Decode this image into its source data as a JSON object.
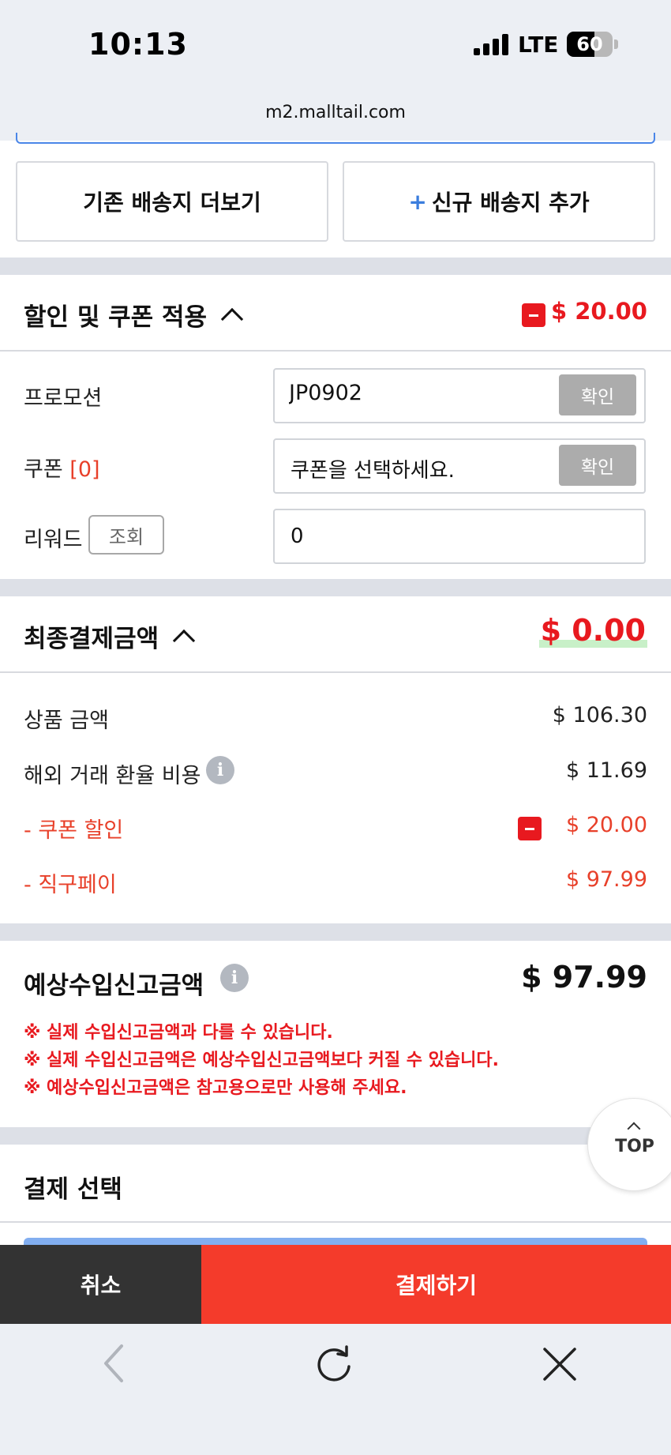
{
  "status": {
    "time": "10:13",
    "network": "LTE",
    "battery": "60"
  },
  "browser": {
    "url": "m2.malltail.com"
  },
  "address_buttons": {
    "more_label": "기존 배송지 더보기",
    "add_plus": "+",
    "add_label": "신규 배송지 추가"
  },
  "discount": {
    "title": "할인 및 쿠폰 적용",
    "amount": "$ 20.00",
    "promotion_label": "프로모션",
    "promotion_value": "JP0902",
    "confirm_label": "확인",
    "coupon_label": "쿠폰",
    "coupon_count": "[0]",
    "coupon_placeholder": "쿠폰을 선택하세요.",
    "reward_label": "리워드",
    "lookup_label": "조회",
    "reward_value": "0"
  },
  "final": {
    "title": "최종결제금액",
    "total": "$ 0.00",
    "rows": [
      {
        "label": "상품 금액",
        "value": "$ 106.30"
      },
      {
        "label": "해외 거래 환율 비용",
        "value": "$ 11.69"
      },
      {
        "label": "- 쿠폰 할인",
        "value": "$ 20.00"
      },
      {
        "label": "- 직구페이",
        "value": "$ 97.99"
      }
    ]
  },
  "customs": {
    "title": "예상수입신고금액",
    "amount": "$ 97.99",
    "notices": [
      "※ 실제 수입신고금액과 다를 수 있습니다.",
      "※ 실제 수입신고금액은 예상수입신고금액보다 커질 수 있습니다.",
      "※ 예상수입신고금액은 참고용으로만 사용해 주세요."
    ]
  },
  "top_button": {
    "label": "TOP"
  },
  "payment": {
    "title": "결제 선택"
  },
  "actions": {
    "cancel": "취소",
    "pay": "결제하기"
  },
  "colors": {
    "accent_red": "#e8191f",
    "pay_button": "#f43b2b",
    "cancel_button": "#333333",
    "link_blue": "#3b7ddd"
  },
  "icons": [
    "minus-icon",
    "chevron-up-icon",
    "info-icon",
    "back-icon",
    "reload-icon",
    "close-icon"
  ]
}
